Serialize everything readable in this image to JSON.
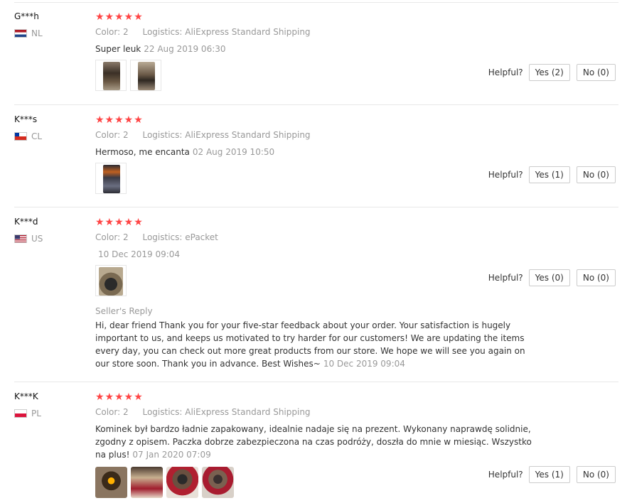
{
  "reviews": [
    {
      "user": "G***h",
      "country": "NL",
      "flag_colors": [
        "#ae1c28",
        "#ffffff",
        "#21468b"
      ],
      "stars": "★★★★★",
      "color_label": "Color:",
      "color_value": "2",
      "logistics_label": "Logistics:",
      "logistics_value": "AliExpress Standard Shipping",
      "text": "Super leuk",
      "date": "22 Aug 2019 06:30",
      "helpful_label": "Helpful?",
      "yes": "Yes (2)",
      "no": "No (0)"
    },
    {
      "user": "K***s",
      "country": "CL",
      "flag_colors": [
        "#0039a6",
        "#ffffff",
        "#d52b1e"
      ],
      "stars": "★★★★★",
      "color_label": "Color:",
      "color_value": "2",
      "logistics_label": "Logistics:",
      "logistics_value": "AliExpress Standard Shipping",
      "text": "Hermoso, me encanta",
      "date": "02 Aug 2019 10:50",
      "helpful_label": "Helpful?",
      "yes": "Yes (1)",
      "no": "No (0)"
    },
    {
      "user": "K***d",
      "country": "US",
      "flag_colors": [
        "#b22234",
        "#ffffff",
        "#3c3b6e"
      ],
      "stars": "★★★★★",
      "color_label": "Color:",
      "color_value": "2",
      "logistics_label": "Logistics:",
      "logistics_value": "ePacket",
      "text": "",
      "date": "10 Dec 2019 09:04",
      "helpful_label": "Helpful?",
      "yes": "Yes (0)",
      "no": "No (0)",
      "reply_title": "Seller's Reply",
      "reply_text": "Hi, dear friend Thank you for your five-star feedback about your order. Your satisfaction is hugely important to us, and keeps us motivated to try harder for our customers! We are updating the items every day, you can check out more great products from our store. We hope we will see you again on our store soon. Thank you in advance. Best Wishes~",
      "reply_date": "10 Dec 2019 09:04"
    },
    {
      "user": "K***K",
      "country": "PL",
      "flag_colors": [
        "#ffffff",
        "#dc143c"
      ],
      "stars": "★★★★★",
      "color_label": "Color:",
      "color_value": "2",
      "logistics_label": "Logistics:",
      "logistics_value": "AliExpress Standard Shipping",
      "text": "Kominek był bardzo ładnie zapakowany, idealnie nadaje się na prezent. Wykonany naprawdę solidnie, zgodny z opisem. Paczka dobrze zabezpieczona na czas podróży, doszła do mnie w miesiąc. Wszystko na plus!",
      "date": "07 Jan 2020 07:09",
      "helpful_label": "Helpful?",
      "yes": "Yes (1)",
      "no": "No (0)"
    }
  ],
  "accent_color": "#ff4747"
}
